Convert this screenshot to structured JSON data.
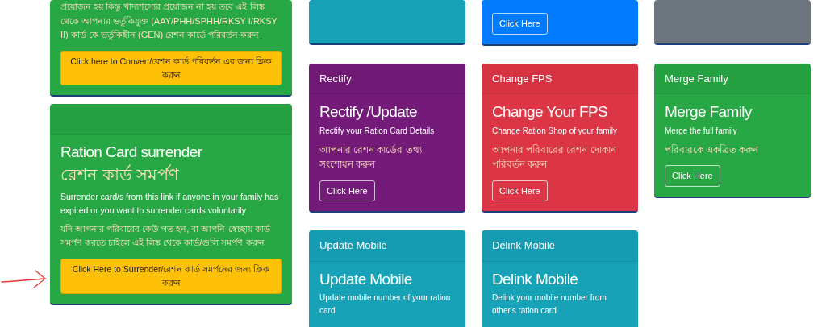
{
  "left_cards": [
    {
      "kind": "convert",
      "text_bn": "প্রয়োজন হয় কিন্তু খাদ্যশস্যের প্রয়োজন না হয় তবে এই লিঙ্ক থেকে আপনার ভর্তুকিযুক্ত (AAY/PHH/SPHH/RKSY I/RKSY II) কার্ড কে ভর্তুকিহীন (GEN) রেশন কার্ডে পরিবর্তন করুন।",
      "button": "Click here to Convert/রেশন কার্ড পরিবর্তন এর জন্য ক্লিক করুন"
    },
    {
      "kind": "surrender",
      "title": "Ration Card surrender",
      "title_bn": "রেশন কার্ড সমর্পণ",
      "text": "Surrender card/s from this link if anyone in your family has expired or you want to surrender cards voluntarily",
      "text_bn": "যদি আপনার পরিবারের কেউ গত হন, বা আপনি স্বেচ্ছায় কার্ড সমর্পণ করতে চাইলে এই লিঙ্ক থেকে কার্ড/গুলি সমর্পণ করুন",
      "button": "Click Here to Surrender/রেশন কার্ড সমর্পনের জন্য ক্লিক করুন"
    }
  ],
  "service_cards": [
    {
      "color": "#17a2b8"
    },
    {
      "color": "#007bff",
      "button": "Click Here"
    },
    {
      "color": "#6c757d"
    },
    {
      "color": "#741b79",
      "header": "Rectify",
      "title": "Rectify /Update",
      "text": "Rectify your Ration Card Details",
      "text_bn": "আপনার রেশন কার্ডের তথ্য সংশোধন করুন",
      "button": "Click Here"
    },
    {
      "color": "#dc3545",
      "header": "Change FPS",
      "title": "Change Your FPS",
      "text": "Change Ration Shop of your family",
      "text_bn": "আপনার পরিবারের রেশন দোকান পরিবর্তন করুন",
      "button": "Click Here"
    },
    {
      "color": "#28a745",
      "header": "Merge Family",
      "title": "Merge Family",
      "text": "Merge the full family",
      "text_bn": "পরিবারকে একত্রিত করুন",
      "button": "Click Here"
    },
    {
      "color": "#17a2b8",
      "header": "Update Mobile",
      "title": "Update Mobile",
      "text": "Update mobile number of your ration card"
    },
    {
      "color": "#17a2b8",
      "header": "Delink Mobile",
      "title": "Delink Mobile",
      "text": "Delink your mobile number from other's ration card"
    }
  ]
}
